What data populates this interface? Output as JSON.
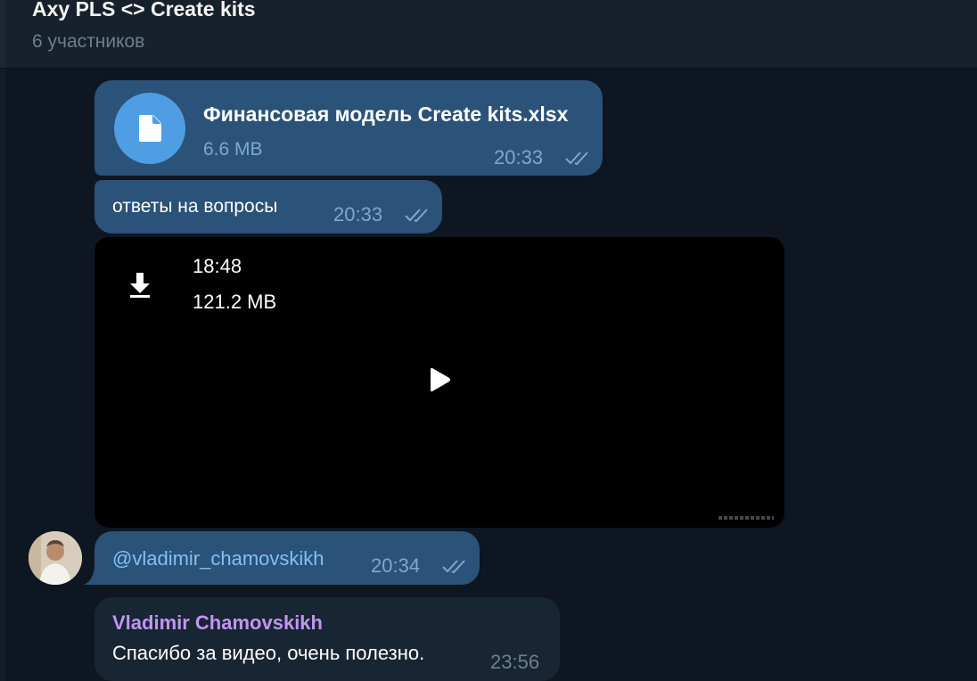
{
  "header": {
    "title": "Axy PLS <> Create kits",
    "subtitle": "6 участников"
  },
  "messages": {
    "file": {
      "name": "Финансовая модель Create kits.xlsx",
      "size": "6.6 MB",
      "time": "20:33",
      "icon": "document-icon"
    },
    "text1": {
      "text": "ответы на вопросы",
      "time": "20:33"
    },
    "video": {
      "duration": "18:48",
      "size": "121.2 MB"
    },
    "mention": {
      "text": "@vladimir_chamovskikh",
      "time": "20:34"
    },
    "reply": {
      "sender": "Vladimir Chamovskikh",
      "text": "Спасибо за видео, очень полезно.",
      "time": "23:56"
    }
  },
  "colors": {
    "background": "#0e1621",
    "header": "#17212b",
    "outgoing_bubble": "#2b5278",
    "incoming_bubble": "#182533",
    "accent": "#4f9ee3",
    "sender_name": "#c195f4",
    "mention": "#7ec1f5"
  }
}
